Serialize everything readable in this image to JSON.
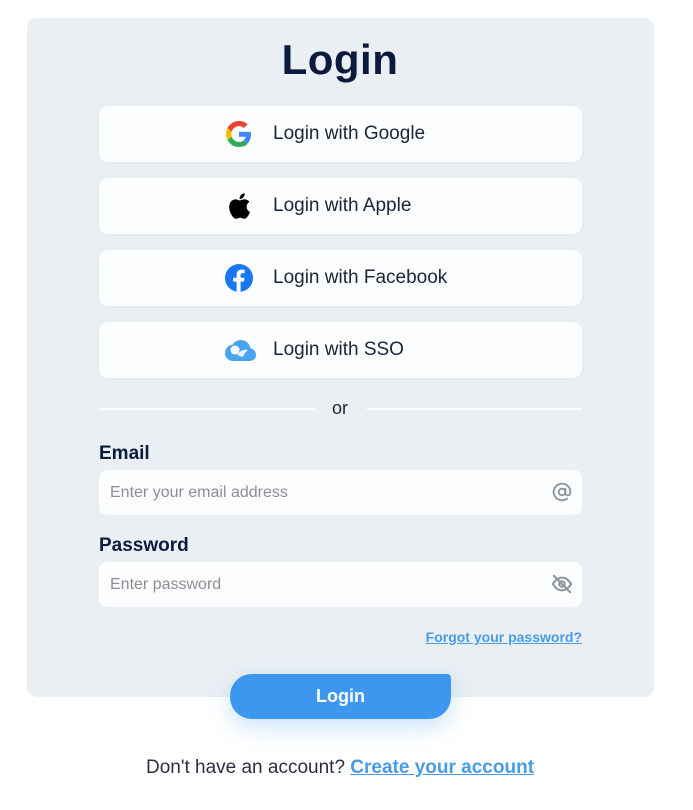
{
  "title": "Login",
  "social": [
    {
      "label": "Login with Google",
      "icon": "google-icon"
    },
    {
      "label": "Login with Apple",
      "icon": "apple-icon"
    },
    {
      "label": "Login with Facebook",
      "icon": "facebook-icon"
    },
    {
      "label": "Login with SSO",
      "icon": "cloud-icon"
    }
  ],
  "divider_text": "or",
  "email": {
    "label": "Email",
    "placeholder": "Enter your email address",
    "icon": "at-icon"
  },
  "password": {
    "label": "Password",
    "placeholder": "Enter password",
    "icon": "eye-off-icon"
  },
  "forgot_label": "Forgot your password?",
  "login_label": "Login",
  "footer": {
    "prompt": "Don't have an account?",
    "link": "Create your account"
  },
  "colors": {
    "card_bg": "#e9eff3",
    "primary": "#3d97ee",
    "link": "#4a9be6",
    "heading": "#0c1a3d",
    "google_blue": "#4285F4",
    "google_red": "#EA4335",
    "google_yellow": "#FBBC05",
    "google_green": "#34A853",
    "facebook": "#1877F2"
  }
}
